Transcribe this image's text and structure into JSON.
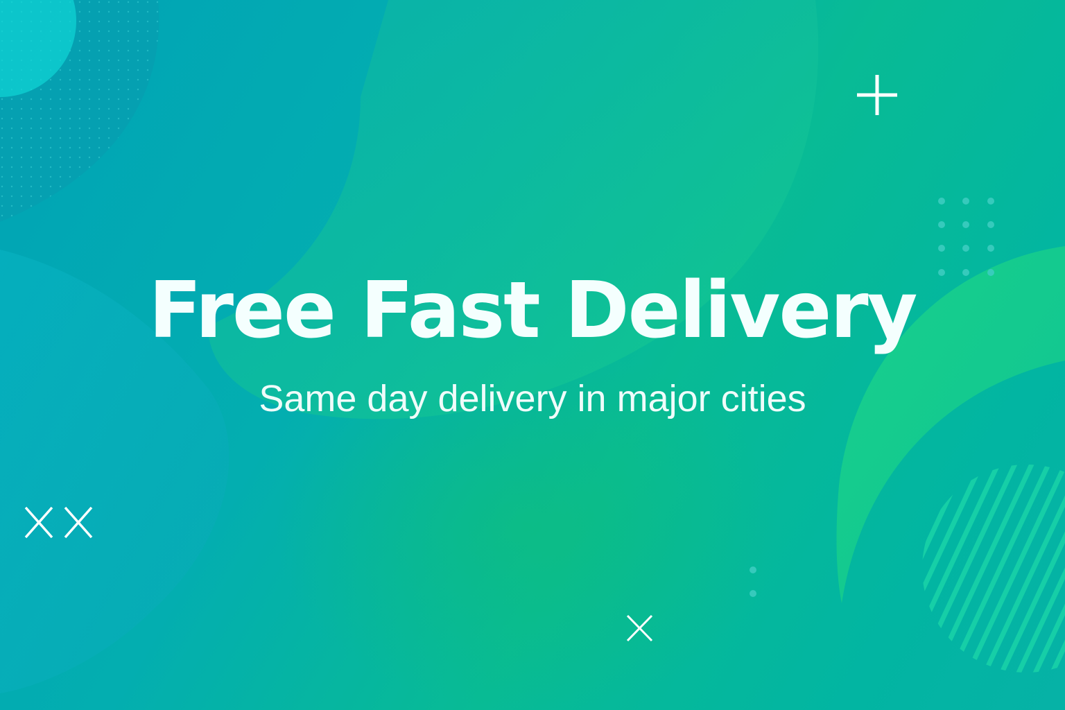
{
  "banner": {
    "headline": "Free Fast Delivery",
    "subheadline": "Same day delivery in major cities"
  },
  "colors": {
    "background_start": "#00A3B6",
    "background_end": "#06B2A6",
    "accent_green": "#12CF8A",
    "text": "#F4FFFE"
  },
  "decorations": [
    "plus-icon",
    "cross-icon",
    "dot-grid",
    "striped-circle",
    "crescent-shape",
    "blob-shape"
  ]
}
